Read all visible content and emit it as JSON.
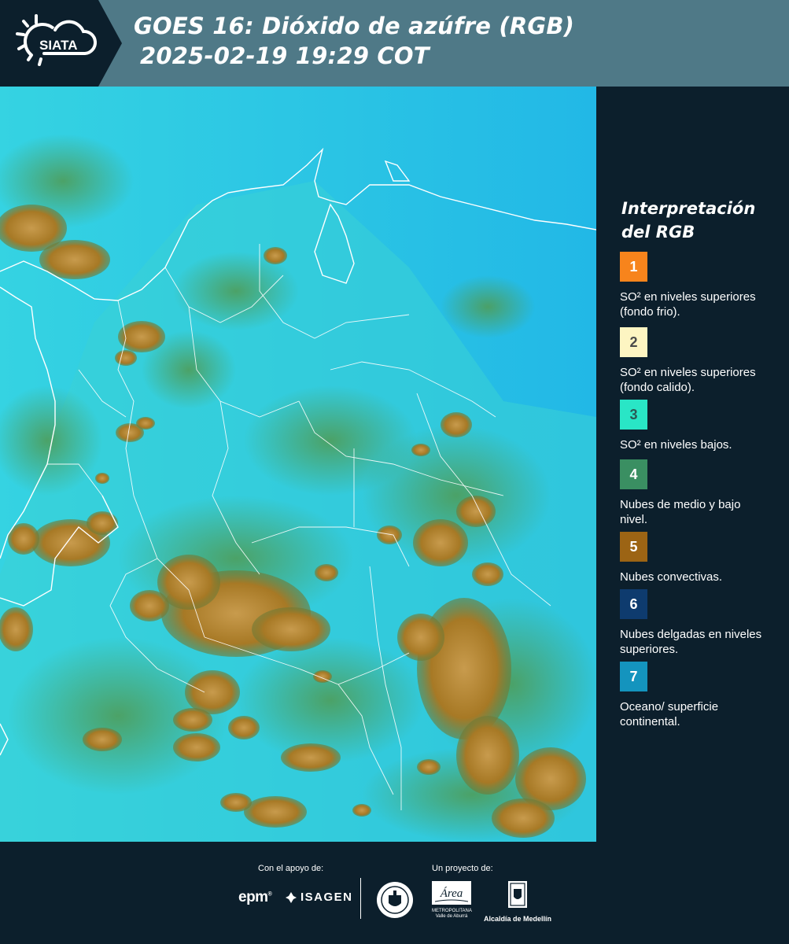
{
  "header": {
    "logo_text": "SIATA",
    "title_line1": "GOES 16: Dióxido de azúfre (RGB)",
    "title_line2": "2025-02-19 19:29 COT"
  },
  "legend": {
    "title_line1": "Interpretación",
    "title_line2": "del RGB",
    "items": [
      {
        "number": "1",
        "label": "SO² en niveles superiores (fondo frio).",
        "color": "#f7841c",
        "text_color": "#ffffff"
      },
      {
        "number": "2",
        "label": "SO² en niveles superiores (fondo calido).",
        "color": "#fdf5c2",
        "text_color": "#4a4a4a"
      },
      {
        "number": "3",
        "label": "SO² en niveles bajos.",
        "color": "#29e6c6",
        "text_color": "#2a5a55"
      },
      {
        "number": "4",
        "label": "Nubes de medio y bajo nivel.",
        "color": "#3a8f62",
        "text_color": "#ffffff"
      },
      {
        "number": "5",
        "label": "Nubes convectivas.",
        "color": "#9c6414",
        "text_color": "#ffffff"
      },
      {
        "number": "6",
        "label": "Nubes delgadas en niveles superiores.",
        "color": "#0e3b6e",
        "text_color": "#ffffff"
      },
      {
        "number": "7",
        "label": "Oceano/ superficie continental.",
        "color": "#1494be",
        "text_color": "#ffffff"
      }
    ]
  },
  "footer": {
    "support_label": "Con el apoyo de:",
    "project_label": "Un proyecto de:",
    "epm": "epm",
    "isagen": "ISAGEN",
    "amva_line1": "Área",
    "amva_line2": "METROPOLITANA",
    "amva_line3": "Valle de Aburrá",
    "alcaldia": "Alcaldía de Medellín"
  }
}
